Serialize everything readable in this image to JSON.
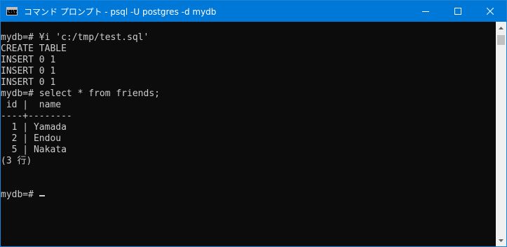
{
  "window": {
    "title": "コマンド プロンプト - psql  -U postgres -d mydb",
    "icon_text": "C:\\."
  },
  "titlebar_controls": [
    "minimize-icon",
    "maximize-icon",
    "close-icon"
  ],
  "console": {
    "lines": [
      "mydb=# ¥i 'c:/tmp/test.sql'",
      "CREATE TABLE",
      "INSERT 0 1",
      "INSERT 0 1",
      "INSERT 0 1",
      "mydb=# select * from friends;",
      " id |  name",
      "----+--------",
      "  1 | Yamada",
      "  2 | Endou",
      "  5 | Nakata",
      "(3 行)",
      "",
      "",
      "mydb=# "
    ]
  },
  "colors": {
    "titlebar": "#0078d7",
    "console_bg": "#0c0c0c",
    "console_fg": "#cccccc",
    "scrollbar_bg": "#f0f0f0"
  }
}
